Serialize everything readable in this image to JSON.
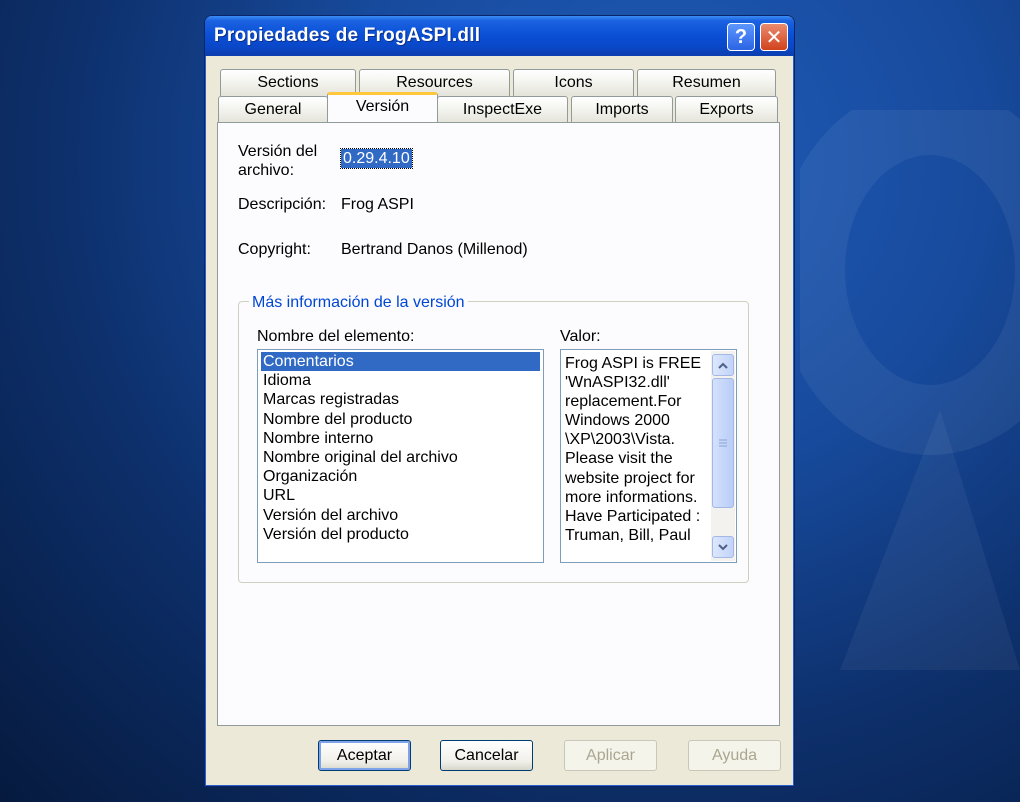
{
  "window": {
    "title": "Propiedades de FrogASPI.dll",
    "help_glyph": "?",
    "close_glyph": "✕"
  },
  "tabs": {
    "row_back": [
      "Sections",
      "Resources",
      "Icons",
      "Resumen"
    ],
    "row_front": [
      "General",
      "Versión",
      "InspectExe",
      "Imports",
      "Exports"
    ],
    "active": "Versión"
  },
  "version_info": {
    "file_version_label": "Versión del archivo:",
    "file_version_value": "0.29.4.10",
    "description_label": "Descripción:",
    "description_value": "Frog ASPI",
    "copyright_label": "Copyright:",
    "copyright_value": "Bertrand Danos (Millenod)"
  },
  "more_info": {
    "legend": "Más información de la versión",
    "items_label": "Nombre del elemento:",
    "value_label": "Valor:",
    "items": [
      "Comentarios",
      "Idioma",
      "Marcas registradas",
      "Nombre del producto",
      "Nombre interno",
      "Nombre original del archivo",
      "Organización",
      "URL",
      "Versión del archivo",
      "Versión del producto"
    ],
    "selected_item": "Comentarios",
    "value_lines": [
      "Frog ASPI is FREE",
      "'WnASPI32.dll'",
      "replacement.For",
      "Windows 2000",
      "\\XP\\2003\\Vista.",
      "Please visit the",
      "website project for",
      "more informations.",
      "Have Participated :",
      "Truman, Bill, Paul"
    ]
  },
  "buttons": {
    "ok": "Aceptar",
    "cancel": "Cancelar",
    "apply": "Aplicar",
    "help": "Ayuda"
  },
  "colors": {
    "selection": "#316ac5",
    "titlebar": "#0a4fd6",
    "group_legend": "#0046d5"
  }
}
